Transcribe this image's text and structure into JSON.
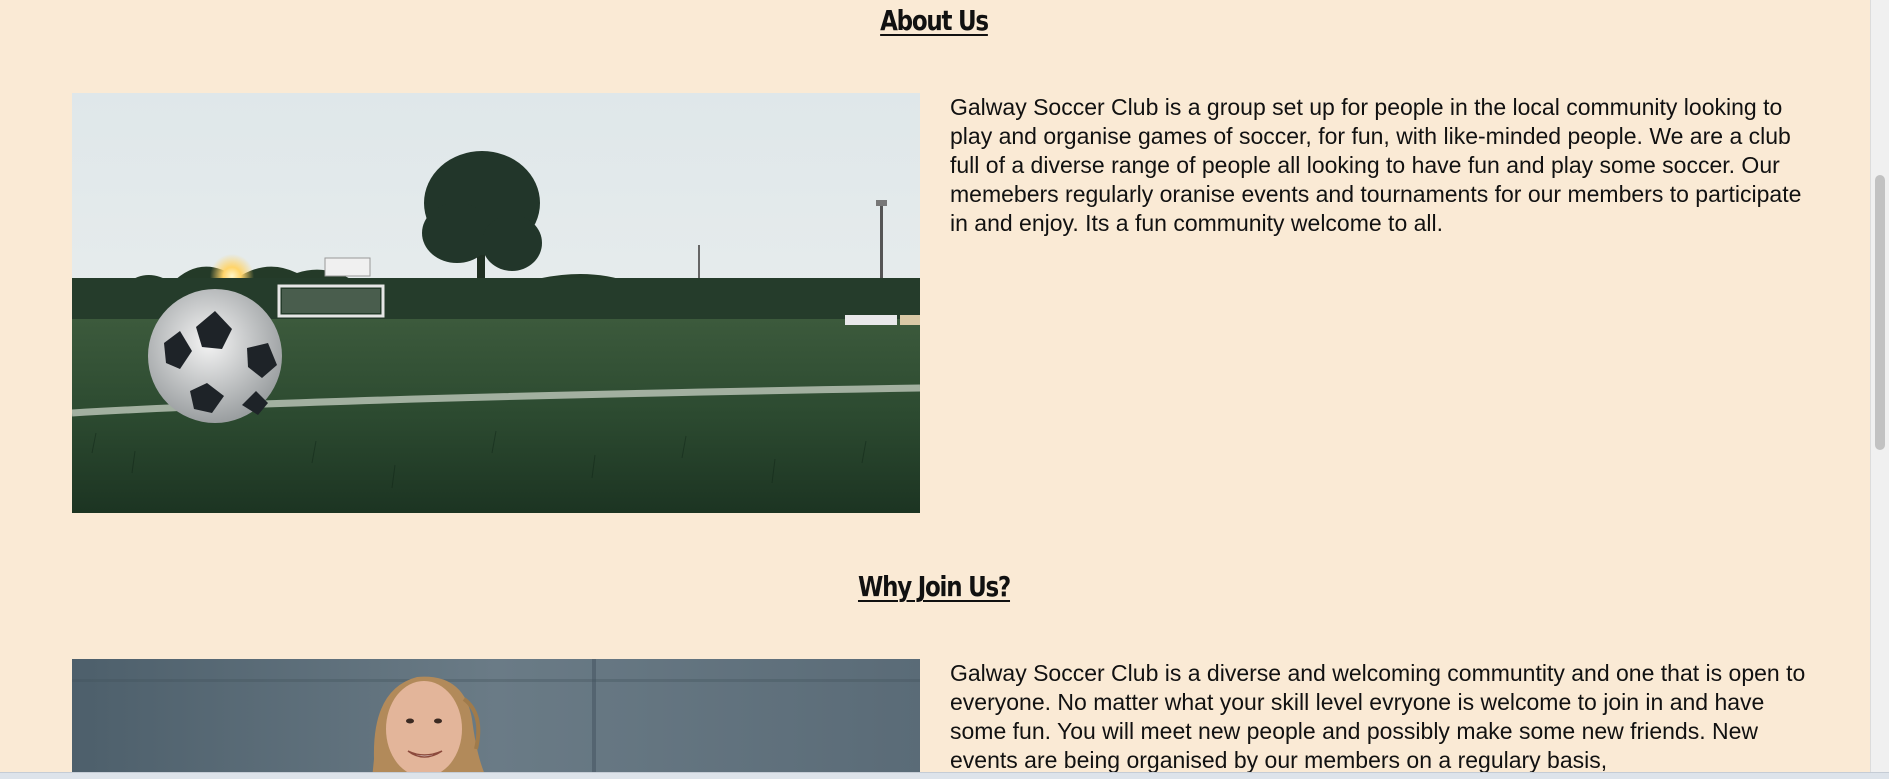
{
  "about": {
    "title": "About Us",
    "paragraph": "Galway Soccer Club is a group set up for people in the local community looking to play and organise games of soccer, for fun, with like-minded people. We are a club full of a diverse range of people all looking to have fun and play some soccer. Our memebers regularly oranise events and tournaments for our members to participate in and enjoy. Its a fun community welcome to all.",
    "image": "soccer-ball-on-field-photo"
  },
  "join": {
    "title": "Why Join Us?",
    "paragraph": "Galway Soccer Club is a diverse and welcoming communtity and one that is open to everyone. No matter what your skill level evryone is welcome to join in and have some fun. You will meet new people and possibly make some new friends. New events are being organised by our members on a regulary basis,",
    "image": "smiling-player-photo"
  },
  "colors": {
    "background": "#faead5",
    "text": "#111111"
  }
}
